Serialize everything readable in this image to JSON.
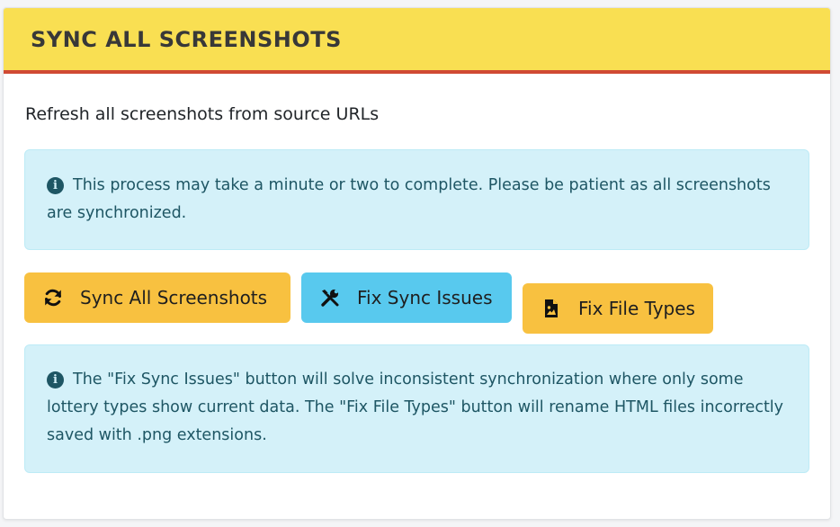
{
  "header": {
    "title": "SYNC ALL SCREENSHOTS"
  },
  "body": {
    "subtitle": "Refresh all screenshots from source URLs",
    "notice": "This process may take a minute or two to complete. Please be patient as all screenshots are synchronized.",
    "buttons": [
      {
        "label": "Sync All Screenshots",
        "icon": "sync-icon",
        "color": "#f8c140"
      },
      {
        "label": "Fix Sync Issues",
        "icon": "tools-icon",
        "color": "#58c9ee"
      },
      {
        "label": "Fix File Types",
        "icon": "file-image-icon",
        "color": "#f8c140"
      }
    ],
    "help": "The \"Fix Sync Issues\" button will solve inconsistent synchronization where only some lottery types show current data. The \"Fix File Types\" button will rename HTML files incorrectly saved with .png extensions."
  },
  "colors": {
    "header_bg": "#f9df52",
    "header_border": "#d04a34",
    "alert_bg": "#d4f1f9",
    "alert_text": "#1e5664"
  }
}
